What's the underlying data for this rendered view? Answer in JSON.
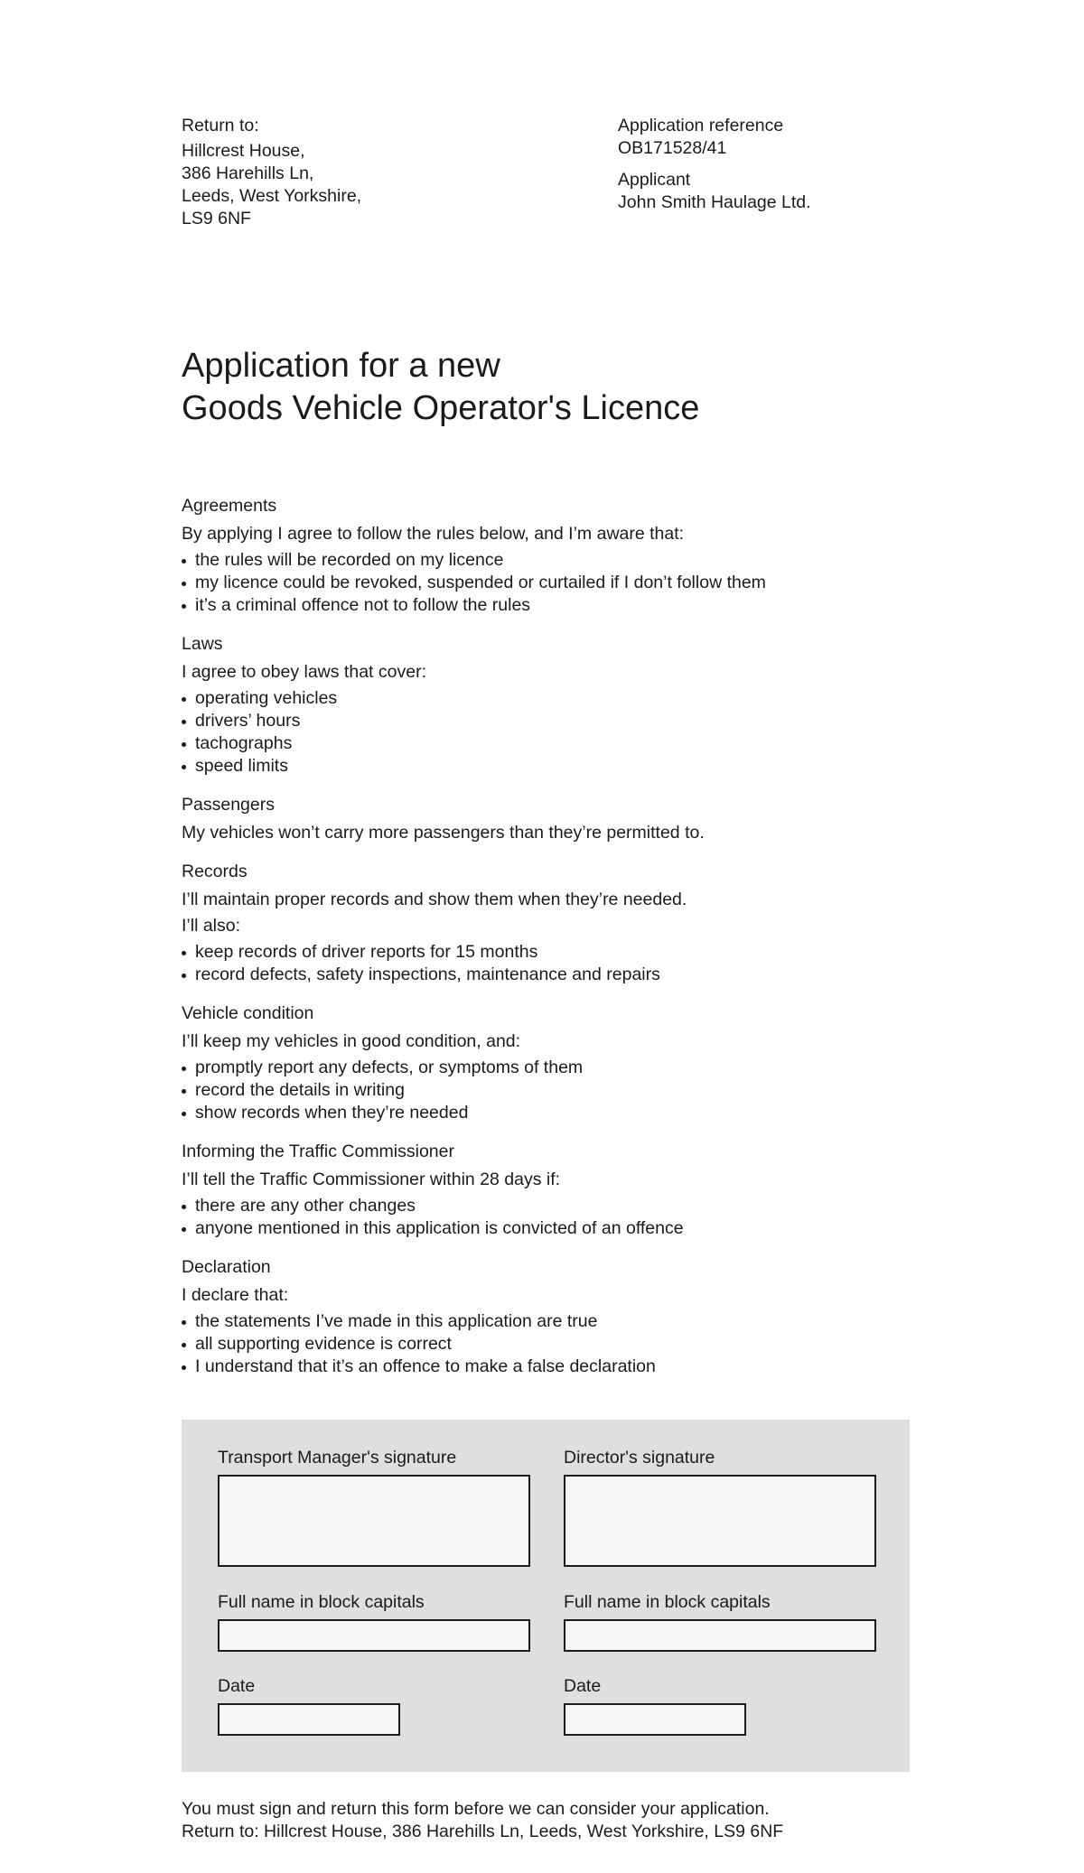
{
  "header": {
    "return_label": "Return to:",
    "return_address": [
      "Hillcrest House,",
      "386 Harehills Ln,",
      "Leeds, West Yorkshire,",
      "LS9 6NF"
    ],
    "reference_label": "Application reference",
    "reference_value": "OB171528/41",
    "applicant_label": "Applicant",
    "applicant_value": "John Smith Haulage Ltd."
  },
  "title": {
    "line1": "Application for a new",
    "line2": "Goods Vehicle Operator's Licence"
  },
  "sections": {
    "agreements": {
      "heading": "Agreements",
      "intro": "By applying I agree to follow the rules below, and I’m aware that:",
      "items": [
        "the rules will be recorded on my licence",
        "my licence could be revoked, suspended or curtailed if I don’t follow them",
        "it’s a criminal offence not to follow the rules"
      ]
    },
    "laws": {
      "heading": "Laws",
      "intro": "I agree to obey laws that cover:",
      "items": [
        "operating vehicles",
        "drivers’ hours",
        "tachographs",
        "speed limits"
      ]
    },
    "passengers": {
      "heading": "Passengers",
      "intro": "My vehicles won’t carry more passengers than they’re permitted to."
    },
    "records": {
      "heading": "Records",
      "intro": "I’ll maintain proper records and show them when they’re needed.",
      "intro2": "I’ll also:",
      "items": [
        "keep records of driver reports for 15 months",
        "record defects, safety inspections, maintenance and repairs"
      ]
    },
    "vehicle_condition": {
      "heading": "Vehicle condition",
      "intro": "I’ll keep my vehicles in good condition, and:",
      "items": [
        "promptly report any defects, or symptoms of them",
        "record the details in writing",
        "show records when they’re needed"
      ]
    },
    "informing": {
      "heading": "Informing the Traffic Commissioner",
      "intro": "I’ll tell the Traffic Commissioner within 28 days if:",
      "items": [
        "there are any other changes",
        "anyone mentioned in this application is convicted of an offence"
      ]
    },
    "declaration": {
      "heading": "Declaration",
      "intro": "I declare that:",
      "items": [
        "the statements I’ve made in this application are true",
        "all supporting evidence is correct",
        "I understand that it’s an offence to make a false declaration"
      ]
    }
  },
  "signatures": {
    "left": {
      "signature_label": "Transport Manager's signature",
      "name_label": "Full name in block capitals",
      "date_label": "Date"
    },
    "right": {
      "signature_label": "Director's signature",
      "name_label": "Full name in block capitals",
      "date_label": "Date"
    }
  },
  "footer": {
    "line1": "You must sign and return this form before we can consider your application.",
    "line2": "Return to: Hillcrest House, 386 Harehills Ln, Leeds, West Yorkshire, LS9 6NF"
  }
}
